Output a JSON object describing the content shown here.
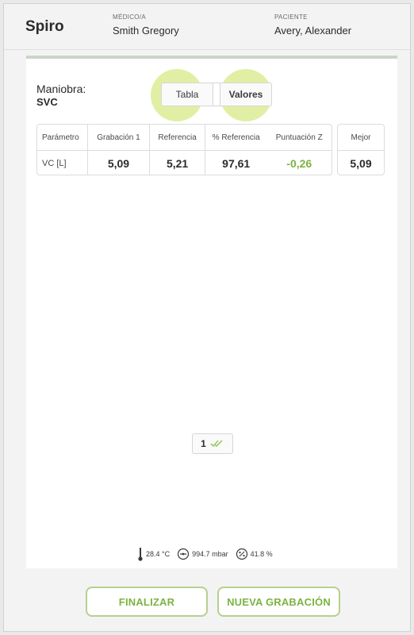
{
  "header": {
    "app_title": "Spiro",
    "doctor_caption": "MÉDICO/A",
    "doctor_name": "Smith Gregory",
    "patient_caption": "PACIENTE",
    "patient_name": "Avery, Alexander"
  },
  "maneuver": {
    "label": "Maniobra:",
    "value": "SVC"
  },
  "view_toggle": {
    "options": [
      "Tabla",
      "Valores"
    ],
    "selected": "Valores"
  },
  "table": {
    "columns": [
      "Parámetro",
      "Grabación 1",
      "Referencia",
      "% Referencia",
      "Puntuación Z"
    ],
    "rows": [
      {
        "parameter": "VC [L]",
        "recording_1": "5,09",
        "reference": "5,21",
        "pct_reference": "97,61",
        "z_score": "-0,26"
      }
    ]
  },
  "best": {
    "header": "Mejor",
    "value": "5,09"
  },
  "recordings": {
    "count_label": "1",
    "status_icon": "double-check-icon"
  },
  "environment": {
    "temperature": "28.4 °C",
    "pressure": "994.7 mbar",
    "humidity": "41.8 %"
  },
  "footer": {
    "finish_label": "FINALIZAR",
    "new_recording_label": "NUEVA GRABACIÓN"
  },
  "colors": {
    "accent_green": "#7cb342",
    "button_border": "#b6d08f",
    "highlight": "#c8e15a"
  }
}
